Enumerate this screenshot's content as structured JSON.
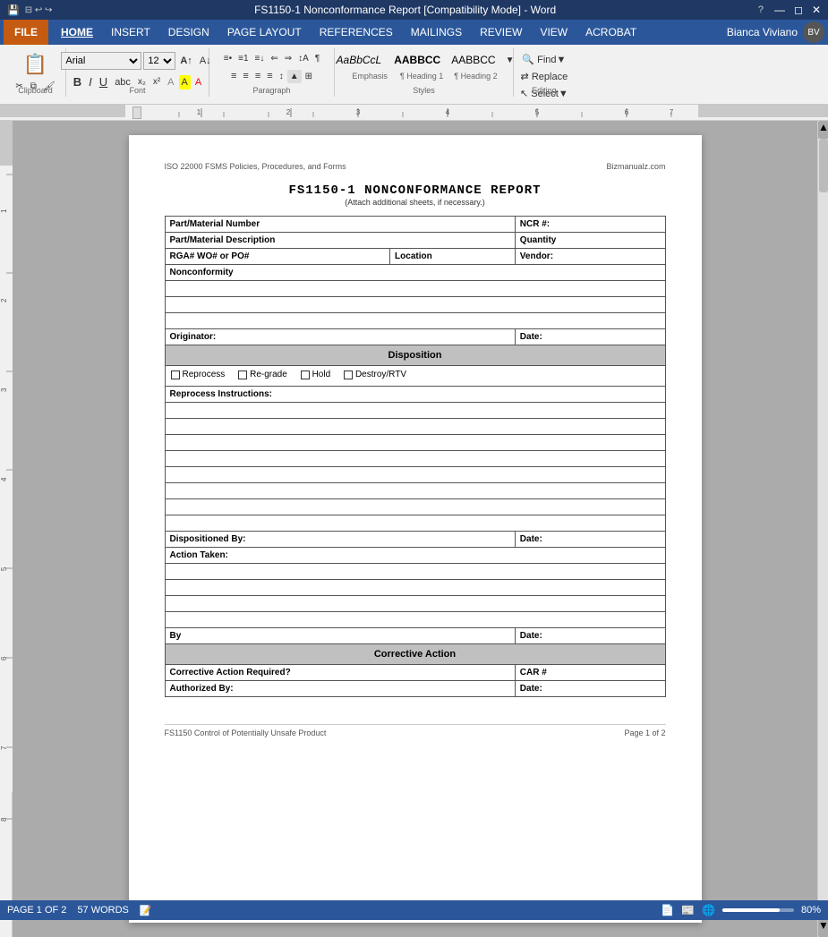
{
  "titlebar": {
    "title": "FS1150-1 Nonconformance Report [Compatibility Mode] - Word",
    "app": "Word"
  },
  "menubar": {
    "file": "FILE",
    "items": [
      "HOME",
      "INSERT",
      "DESIGN",
      "PAGE LAYOUT",
      "REFERENCES",
      "MAILINGS",
      "REVIEW",
      "VIEW",
      "ACROBAT"
    ]
  },
  "ribbon": {
    "clipboard": "Clipboard",
    "font_group": "Font",
    "paragraph_group": "Paragraph",
    "styles_group": "Styles",
    "editing_group": "Editing",
    "font_name": "Arial",
    "font_size": "12",
    "bold": "B",
    "italic": "I",
    "underline": "U",
    "find": "Find",
    "replace": "Replace",
    "select": "Select",
    "styles": [
      "Emphasis",
      "¶ Heading 1",
      "¶ Heading 2"
    ],
    "style_samples": [
      "AaBbCcL",
      "AABBCC",
      "AABBCC"
    ]
  },
  "user": {
    "name": "Bianca Viviano"
  },
  "document": {
    "header_left": "ISO 22000 FSMS Policies, Procedures, and Forms",
    "header_right": "Bizmanualz.com",
    "title": "FS1150-1   NONCONFORMANCE REPORT",
    "subtitle": "(Attach additional sheets, if necessary.)",
    "form": {
      "part_material_number_label": "Part/Material Number",
      "ncr_label": "NCR #:",
      "part_material_desc_label": "Part/Material Description",
      "quantity_label": "Quantity",
      "rga_label": "RGA# WO# or PO#",
      "location_label": "Location",
      "vendor_label": "Vendor:",
      "nonconformity_label": "Nonconformity",
      "originator_label": "Originator:",
      "date_label": "Date:",
      "disposition_header": "Disposition",
      "reprocess": "Reprocess",
      "regrade": "Re-grade",
      "hold": "Hold",
      "destroy": "Destroy/RTV",
      "reprocess_instructions_label": "Reprocess Instructions:",
      "dispositioned_by_label": "Dispositioned By:",
      "date2_label": "Date:",
      "action_taken_label": "Action Taken:",
      "by_label": "By",
      "date3_label": "Date:",
      "corrective_action_header": "Corrective Action",
      "corrective_action_required_label": "Corrective Action Required?",
      "car_label": "CAR #",
      "authorized_by_label": "Authorized By:",
      "date4_label": "Date:"
    },
    "footer_left": "FS1150 Control of Potentially Unsafe Product",
    "footer_right": "Page 1 of 2"
  },
  "statusbar": {
    "page_info": "PAGE 1 OF 2",
    "word_count": "57 WORDS",
    "zoom": "80%"
  }
}
